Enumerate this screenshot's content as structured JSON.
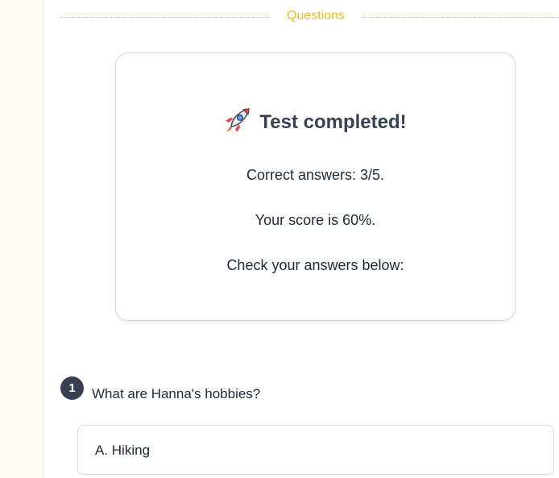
{
  "section": {
    "label": "Questions"
  },
  "result": {
    "title": "Test completed!",
    "icon": "rocket-icon",
    "correct_answers": "Correct answers: 3/5.",
    "score": "Your score is 60%.",
    "check_prompt": "Check your answers below:"
  },
  "questions": [
    {
      "number": "1",
      "text": "What are Hanna's hobbies?",
      "options": [
        {
          "label": "A. Hiking"
        }
      ]
    }
  ],
  "colors": {
    "accent_yellow": "#e9bd1c",
    "badge_dark": "#374151",
    "card_border": "#d9d9d9"
  }
}
